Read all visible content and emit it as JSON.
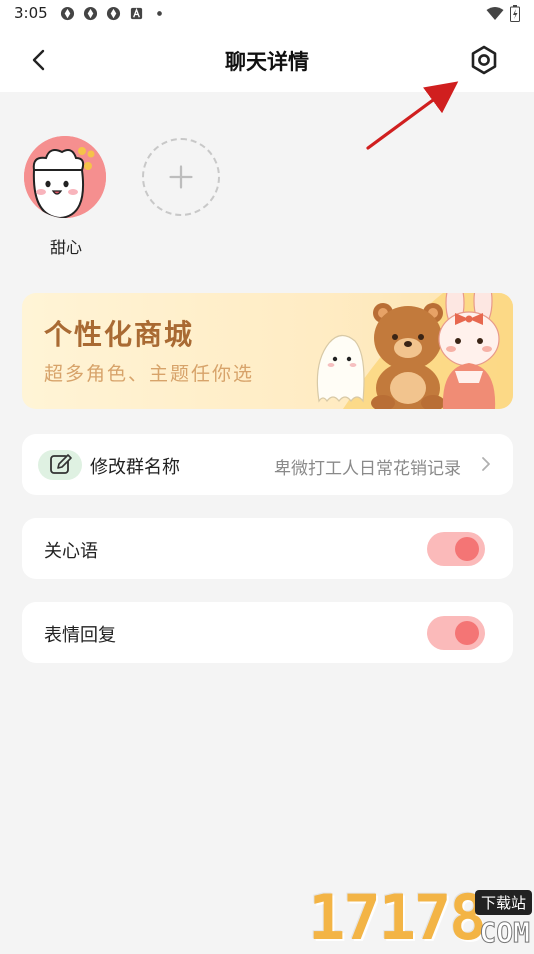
{
  "status_bar": {
    "time": "3:05"
  },
  "header": {
    "title": "聊天详情"
  },
  "members": [
    {
      "name": "甜心"
    }
  ],
  "banner": {
    "title": "个性化商城",
    "subtitle": "超多角色、主题任你选"
  },
  "settings": {
    "group_name": {
      "label": "修改群名称",
      "value": "卑微打工人日常花销记录"
    },
    "care_words": {
      "label": "关心语",
      "enabled": true
    },
    "emoji_reply": {
      "label": "表情回复",
      "enabled": true
    }
  },
  "watermark": {
    "digits": "17178",
    "tag": "下载站",
    "domain": "COM"
  },
  "colors": {
    "toggle_track": "#fbbaba",
    "toggle_knob": "#f47575",
    "banner_title": "#a96a33",
    "arrow": "#d01f1f"
  }
}
